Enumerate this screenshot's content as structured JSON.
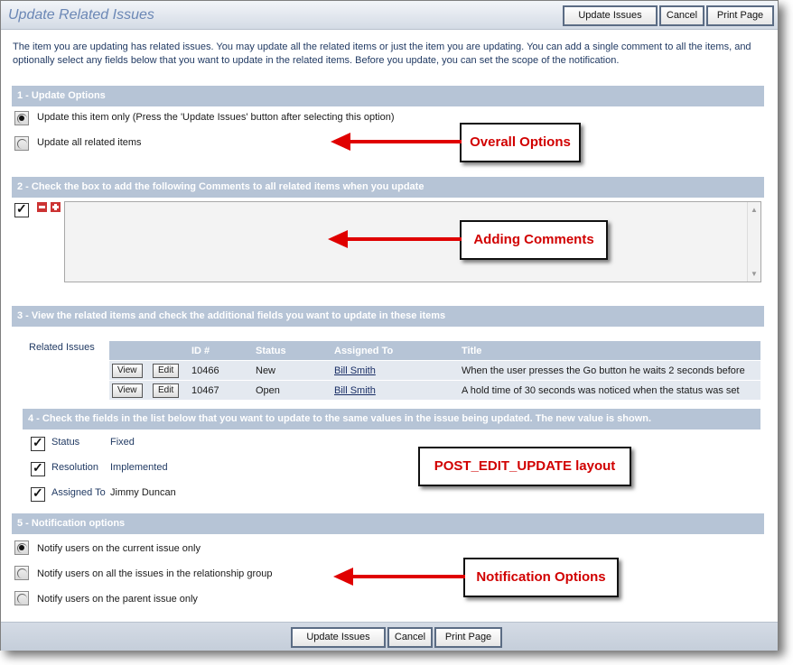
{
  "header": {
    "title": "Update Related Issues",
    "buttons": {
      "update": "Update Issues",
      "cancel": "Cancel",
      "print": "Print Page"
    }
  },
  "intro": "The item you are updating has related issues. You may update all the related items or just the item you are updating. You can add a single comment to all the items, and optionally select any fields below that you want to update in the related items. Before you update, you can set the scope of the notification.",
  "sections": {
    "s1": "1 - Update Options",
    "s2": "2 - Check the box to add the following Comments to all related items when you update",
    "s3": "3 - View the related items and check the additional fields you want to update in these items",
    "s4": "4 - Check the fields in the list below that you want to update to the same values in the issue being updated. The new value is shown.",
    "s5": "5 - Notification options"
  },
  "update_options": [
    {
      "label": "Update this item only (Press the 'Update Issues' button after selecting this option)",
      "selected": true
    },
    {
      "label": "Update all related items",
      "selected": false
    }
  ],
  "comments": {
    "checked": true,
    "value": ""
  },
  "related": {
    "label": "Related Issues",
    "columns": [
      "",
      "",
      "ID #",
      "Status",
      "Assigned To",
      "Title"
    ],
    "view_label": "View",
    "edit_label": "Edit",
    "rows": [
      {
        "id": "10466",
        "status": "New",
        "assigned": "Bill Smith",
        "title": "When the user presses the Go button he waits 2 seconds before"
      },
      {
        "id": "10467",
        "status": "Open",
        "assigned": "Bill Smith",
        "title": "A hold time of 30 seconds was noticed when the status was set"
      }
    ]
  },
  "fields": [
    {
      "name": "Status",
      "value": "Fixed",
      "checked": true
    },
    {
      "name": "Resolution",
      "value": "Implemented",
      "checked": true
    },
    {
      "name": "Assigned To",
      "value": "Jimmy Duncan",
      "checked": true
    }
  ],
  "notification_options": [
    {
      "label": "Notify users on the current issue only",
      "selected": true
    },
    {
      "label": "Notify users on all the issues in the relationship group",
      "selected": false
    },
    {
      "label": "Notify users on the parent issue only",
      "selected": false
    }
  ],
  "callouts": {
    "overall": "Overall Options",
    "comments": "Adding Comments",
    "layout": "POST_EDIT_UPDATE layout",
    "notification": "Notification Options"
  },
  "footer": {
    "update": "Update Issues",
    "cancel": "Cancel",
    "print": "Print Page"
  },
  "colors": {
    "section_bar": "#b6c4d6",
    "title": "#6b87b5",
    "callout_text": "#d10000",
    "arrow": "#e00000"
  }
}
